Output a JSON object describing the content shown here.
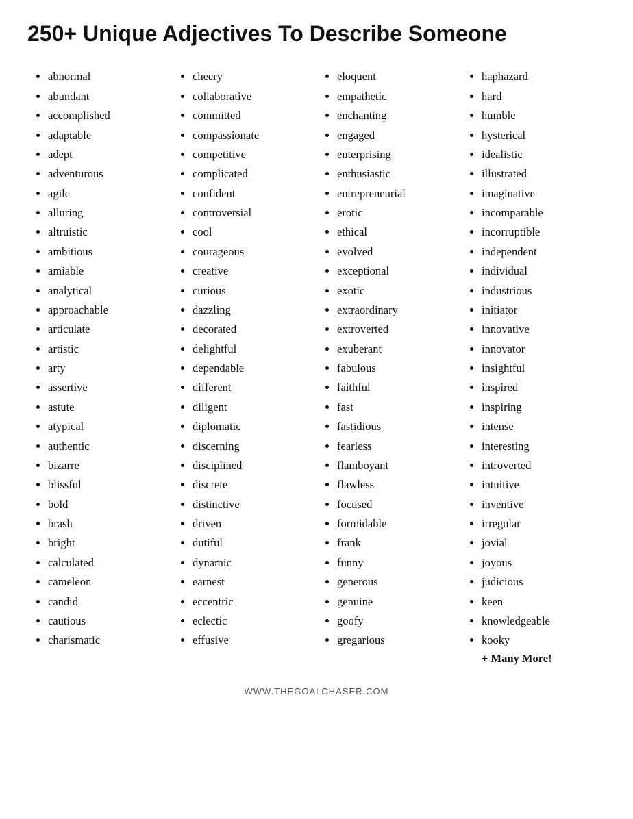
{
  "title": "250+ Unique Adjectives To Describe Someone",
  "columns": [
    {
      "id": "col1",
      "items": [
        "abnormal",
        "abundant",
        "accomplished",
        "adaptable",
        "adept",
        "adventurous",
        "agile",
        "alluring",
        "altruistic",
        "ambitious",
        "amiable",
        "analytical",
        "approachable",
        "articulate",
        "artistic",
        "arty",
        "assertive",
        "astute",
        "atypical",
        "authentic",
        "bizarre",
        "blissful",
        "bold",
        "brash",
        "bright",
        "calculated",
        "cameleon",
        "candid",
        "cautious",
        "charismatic"
      ]
    },
    {
      "id": "col2",
      "items": [
        "cheery",
        "collaborative",
        "committed",
        "compassionate",
        "competitive",
        "complicated",
        "confident",
        "controversial",
        "cool",
        "courageous",
        "creative",
        "curious",
        "dazzling",
        "decorated",
        "delightful",
        "dependable",
        "different",
        "diligent",
        "diplomatic",
        "discerning",
        "disciplined",
        "discrete",
        "distinctive",
        "driven",
        "dutiful",
        "dynamic",
        "earnest",
        "eccentric",
        "eclectic",
        "effusive"
      ]
    },
    {
      "id": "col3",
      "items": [
        "eloquent",
        "empathetic",
        "enchanting",
        "engaged",
        "enterprising",
        "enthusiastic",
        "entrepreneurial",
        "erotic",
        "ethical",
        "evolved",
        "exceptional",
        "exotic",
        "extraordinary",
        "extroverted",
        "exuberant",
        "fabulous",
        "faithful",
        "fast",
        "fastidious",
        "fearless",
        "flamboyant",
        "flawless",
        "focused",
        "formidable",
        "frank",
        "funny",
        "generous",
        "genuine",
        "goofy",
        "gregarious"
      ]
    },
    {
      "id": "col4",
      "items": [
        "haphazard",
        "hard",
        "humble",
        "hysterical",
        "idealistic",
        "illustrated",
        "imaginative",
        "incomparable",
        "incorruptible",
        "independent",
        "individual",
        "industrious",
        "initiator",
        "innovative",
        "innovator",
        "insightful",
        "inspired",
        "inspiring",
        "intense",
        "interesting",
        "introverted",
        "intuitive",
        "inventive",
        "irregular",
        "jovial",
        "joyous",
        "judicious",
        "keen",
        "knowledgeable",
        "kooky"
      ],
      "extra": "+ Many More!"
    }
  ],
  "footer": "WWW.THEGOALCHASER.COM"
}
